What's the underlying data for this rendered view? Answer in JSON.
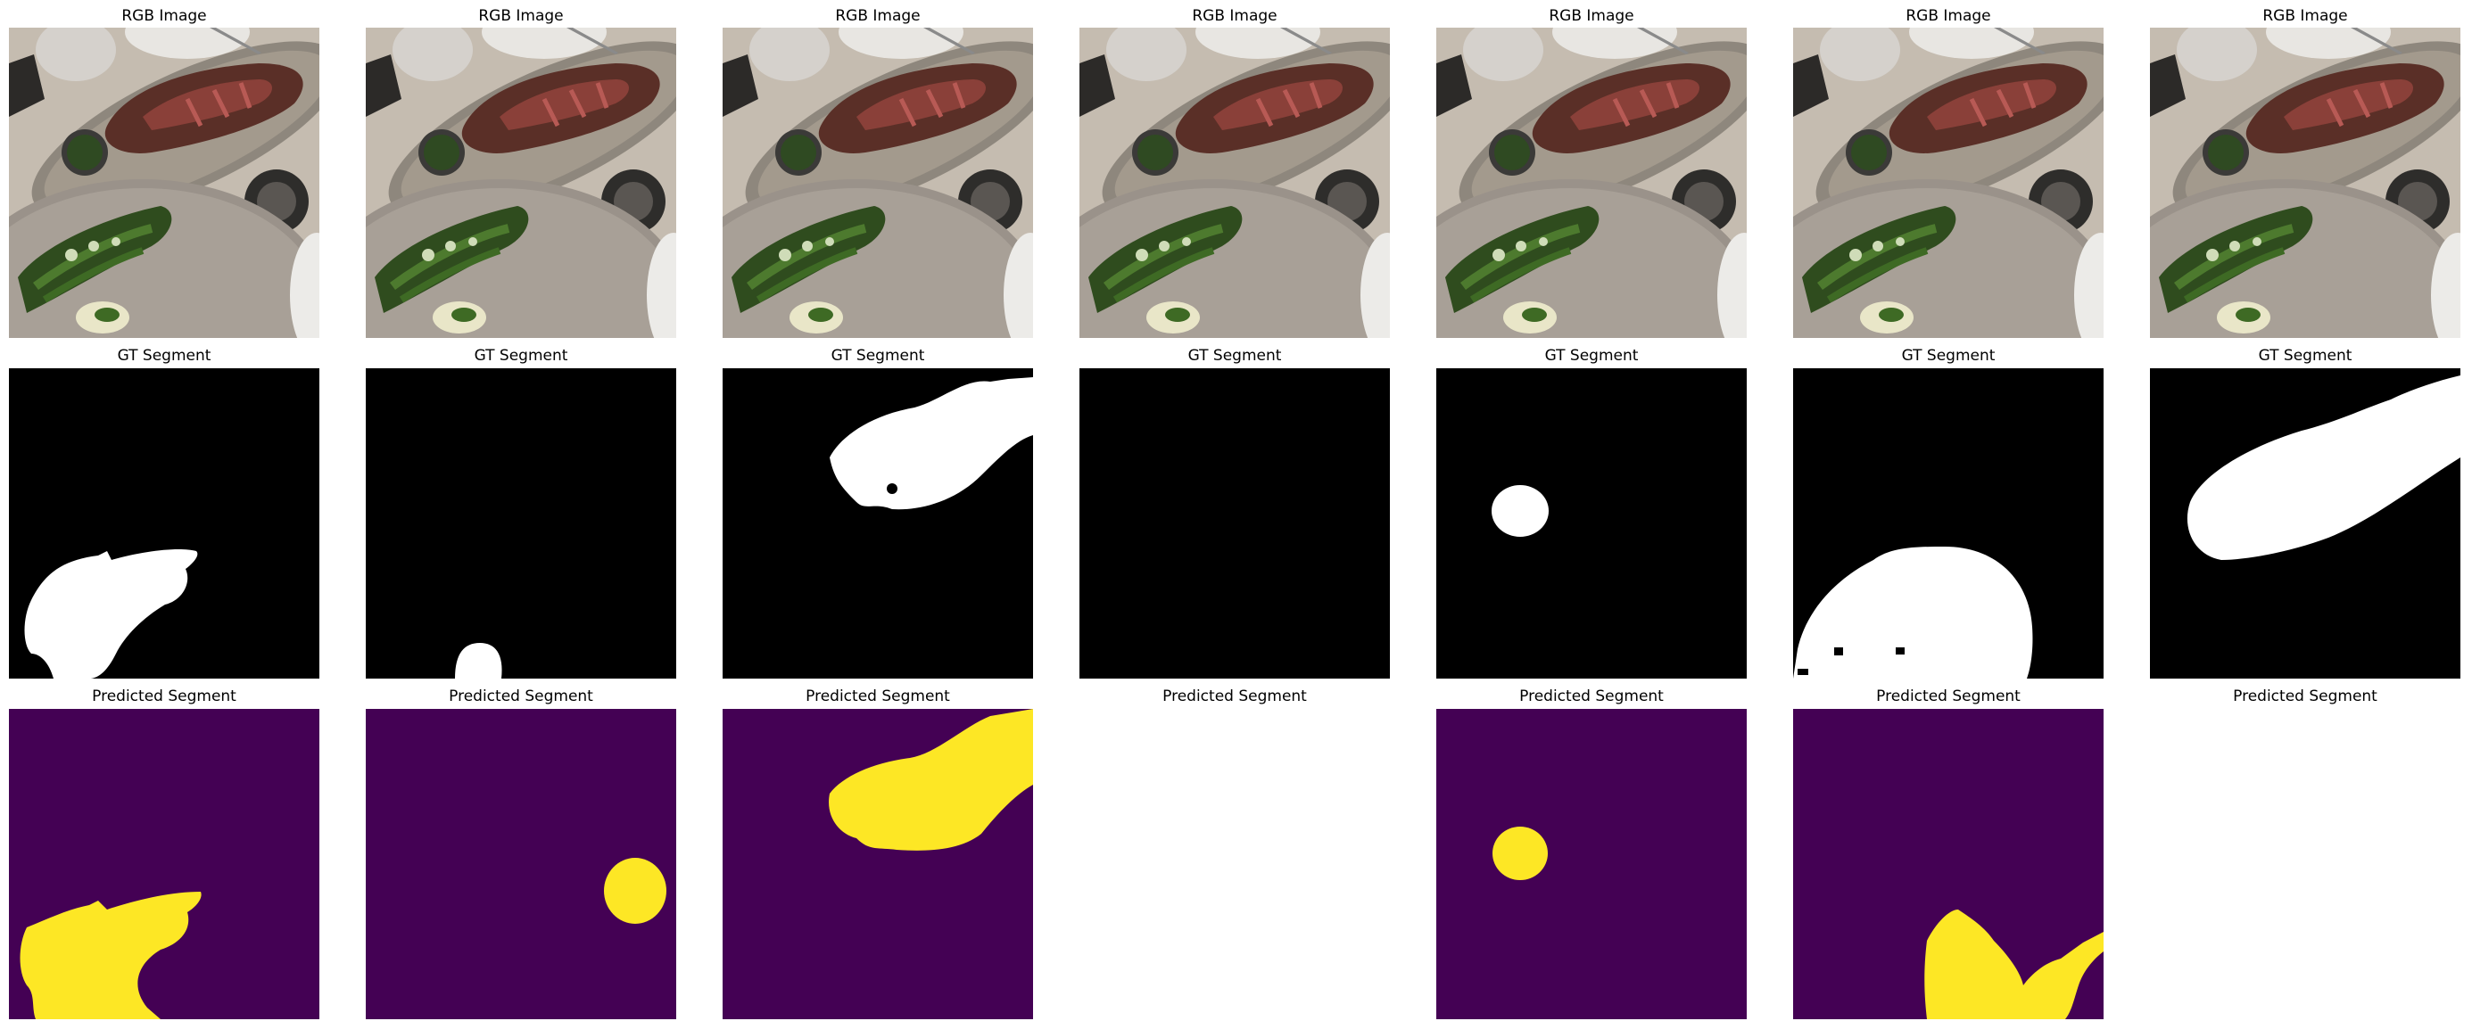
{
  "row_titles": {
    "rgb": "RGB Image",
    "gt": "GT Segment",
    "pred": "Predicted Segment"
  },
  "colors": {
    "mask_background": "#000000",
    "mask_foreground": "#ffffff",
    "pred_background": "#440154",
    "pred_foreground": "#fde725"
  },
  "columns": [
    {
      "gt_mask": "lower-left region",
      "pred_shown": true,
      "pred_mask": "lower-left region"
    },
    {
      "gt_mask": "small blob bottom",
      "pred_shown": true,
      "pred_mask": "round blob right"
    },
    {
      "gt_mask": "upper-right region",
      "pred_shown": true,
      "pred_mask": "upper-right region"
    },
    {
      "gt_mask": "empty",
      "pred_shown": false,
      "pred_mask": "none"
    },
    {
      "gt_mask": "small round blob",
      "pred_shown": true,
      "pred_mask": "small round blob"
    },
    {
      "gt_mask": "large round region bottom",
      "pred_shown": true,
      "pred_mask": "bottom region"
    },
    {
      "gt_mask": "diagonal elongated region",
      "pred_shown": false,
      "pred_mask": "none"
    }
  ]
}
